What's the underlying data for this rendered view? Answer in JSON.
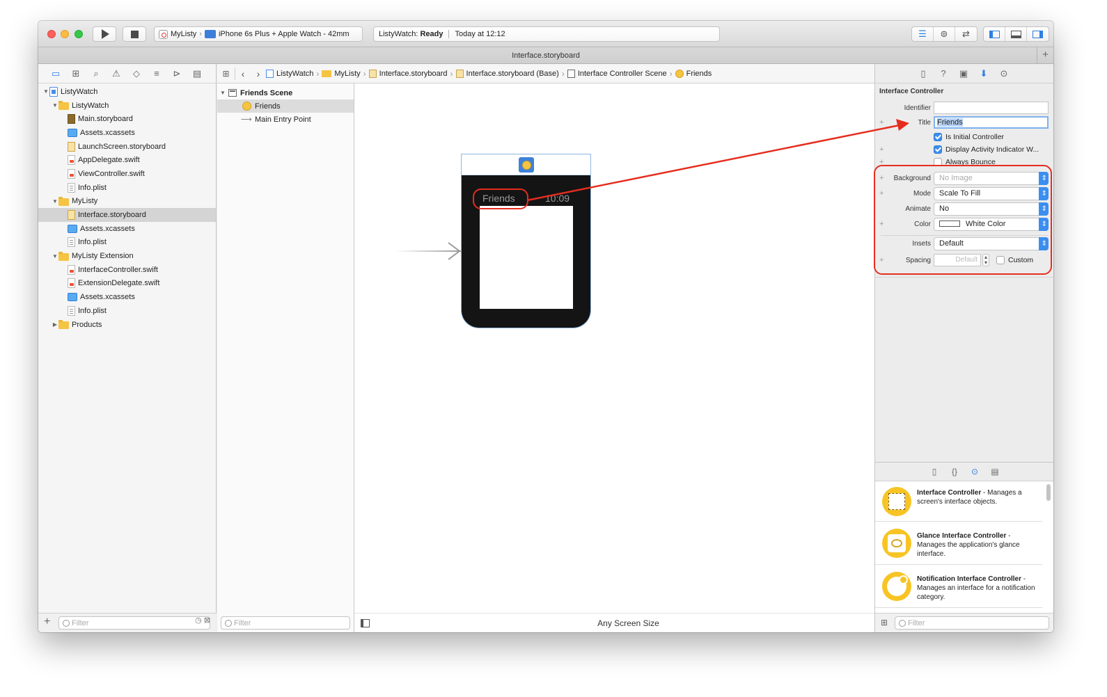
{
  "toolbar": {
    "scheme_app": "MyListy",
    "scheme_device": "iPhone 6s Plus + Apple Watch - 42mm",
    "activity_target": "ListyWatch:",
    "activity_status": "Ready",
    "activity_time": "Today at 12:12"
  },
  "tab": {
    "title": "Interface.storyboard"
  },
  "navigator": {
    "tree": [
      {
        "label": "ListyWatch",
        "icon": "project-icon",
        "level": 0,
        "disclosure": "open"
      },
      {
        "label": "ListyWatch",
        "icon": "folder-icon",
        "level": 1,
        "disclosure": "open"
      },
      {
        "label": "Main.storyboard",
        "icon": "storyboard-dark-icon",
        "level": 2
      },
      {
        "label": "Assets.xcassets",
        "icon": "asset-catalog-icon",
        "level": 2
      },
      {
        "label": "LaunchScreen.storyboard",
        "icon": "storyboard-icon",
        "level": 2
      },
      {
        "label": "AppDelegate.swift",
        "icon": "swift-file-icon",
        "level": 2
      },
      {
        "label": "ViewController.swift",
        "icon": "swift-file-icon",
        "level": 2
      },
      {
        "label": "Info.plist",
        "icon": "plist-icon",
        "level": 2
      },
      {
        "label": "MyListy",
        "icon": "folder-icon",
        "level": 1,
        "disclosure": "open"
      },
      {
        "label": "Interface.storyboard",
        "icon": "storyboard-icon",
        "level": 2,
        "selected": true
      },
      {
        "label": "Assets.xcassets",
        "icon": "asset-catalog-icon",
        "level": 2
      },
      {
        "label": "Info.plist",
        "icon": "plist-icon",
        "level": 2
      },
      {
        "label": "MyListy Extension",
        "icon": "folder-icon",
        "level": 1,
        "disclosure": "open"
      },
      {
        "label": "InterfaceController.swift",
        "icon": "swift-file-icon",
        "level": 2
      },
      {
        "label": "ExtensionDelegate.swift",
        "icon": "swift-file-icon",
        "level": 2
      },
      {
        "label": "Assets.xcassets",
        "icon": "asset-catalog-icon",
        "level": 2
      },
      {
        "label": "Info.plist",
        "icon": "plist-icon",
        "level": 2
      },
      {
        "label": "Products",
        "icon": "folder-icon",
        "level": 1,
        "disclosure": "closed"
      }
    ],
    "filter_placeholder": "Filter"
  },
  "jumpbar": {
    "crumbs": [
      "ListyWatch",
      "MyListy",
      "Interface.storyboard",
      "Interface.storyboard (Base)",
      "Interface Controller Scene",
      "Friends"
    ]
  },
  "outline": {
    "scene": "Friends Scene",
    "controller": "Friends",
    "entry": "Main Entry Point",
    "filter_placeholder": "Filter"
  },
  "canvas": {
    "watch_title": "Friends",
    "watch_time": "10:09",
    "size_class": "Any Screen Size"
  },
  "inspector": {
    "section": "Interface Controller",
    "identifier_label": "Identifier",
    "identifier_value": "",
    "title_label": "Title",
    "title_value": "Friends",
    "initial_label": "Is Initial Controller",
    "activity_label": "Display Activity Indicator W...",
    "bounce_label": "Always Bounce",
    "background_label": "Background",
    "background_value": "No Image",
    "mode_label": "Mode",
    "mode_value": "Scale To Fill",
    "animate_label": "Animate",
    "animate_value": "No",
    "color_label": "Color",
    "color_value": "White Color",
    "insets_label": "Insets",
    "insets_value": "Default",
    "spacing_label": "Spacing",
    "spacing_value": "Default",
    "custom_label": "Custom"
  },
  "library": {
    "items": [
      {
        "name": "Interface Controller",
        "desc": " - Manages a screen's interface objects."
      },
      {
        "name": "Glance Interface Controller",
        "desc": " - Manages the application's glance interface."
      },
      {
        "name": "Notification Interface Controller",
        "desc": " - Manages an interface for a notification category."
      }
    ],
    "filter_placeholder": "Filter"
  },
  "colors": {
    "accent": "#2d7fe3",
    "annotation": "#e52d1f",
    "watch_body": "#141414",
    "library_icon": "#f7c424"
  }
}
